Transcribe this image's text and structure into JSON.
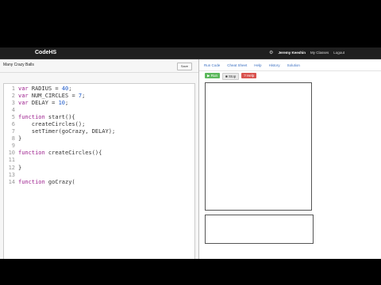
{
  "topbar": {
    "brand": "CodeHS",
    "user": "Jeremy Keeshin",
    "my_classes": "My Classes",
    "logout": "Logout"
  },
  "editor": {
    "program_title": "Many Crazy Balls",
    "save_label": "Save",
    "line_numbers": [
      "1",
      "2",
      "3",
      "4",
      "5",
      "6",
      "7",
      "8",
      "9",
      "10",
      "11",
      "12",
      "13",
      "14"
    ],
    "lines": [
      "var RADIUS = 40;",
      "var NUM_CIRCLES = 7;",
      "var DELAY = 10;",
      "",
      "function start(){",
      "    createCircles();",
      "    setTimer(goCrazy, DELAY);",
      "}",
      "",
      "function createCircles(){",
      "",
      "}",
      "",
      "function goCrazy("
    ]
  },
  "right_panel": {
    "tabs": [
      "Run Code",
      "Cheat Sheet",
      "Help",
      "History",
      "Solution"
    ],
    "run_label": "Run",
    "stop_label": "Stop",
    "help_label": "Help"
  },
  "colors": {
    "run": "#5cb85c",
    "help": "#d9534f",
    "keyword": "#9b1c8c"
  }
}
